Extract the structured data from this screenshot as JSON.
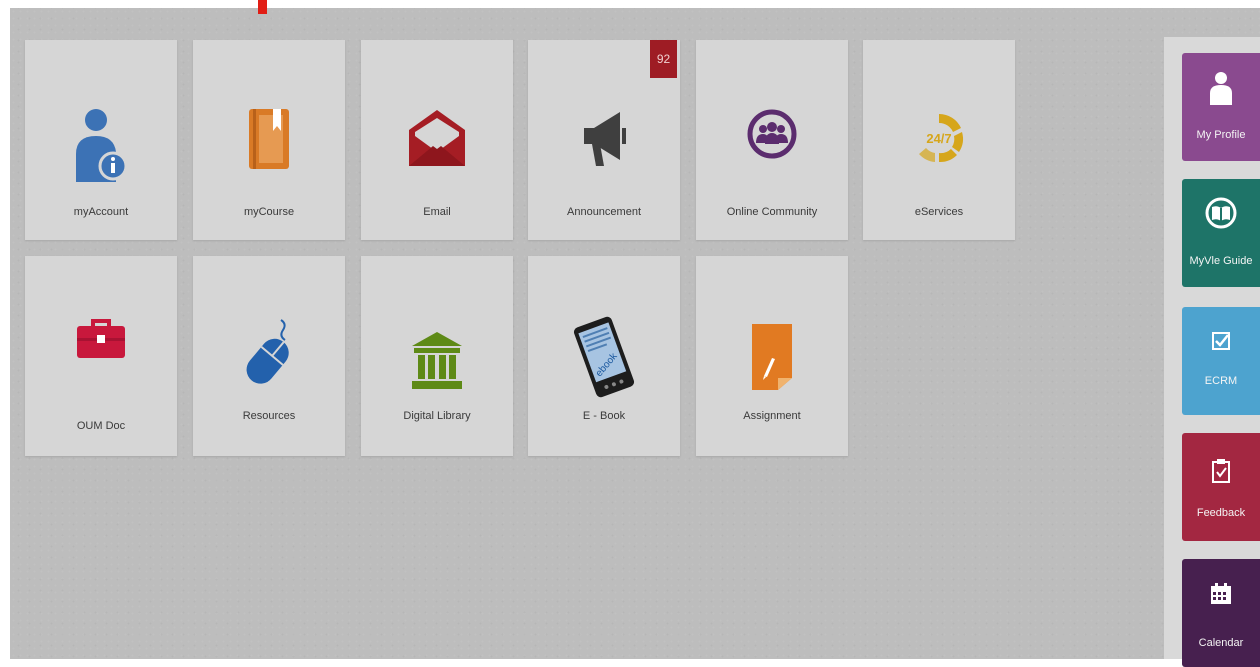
{
  "tiles": [
    {
      "label": "myAccount"
    },
    {
      "label": "myCourse"
    },
    {
      "label": "Email"
    },
    {
      "label": "Announcement",
      "badge": "92"
    },
    {
      "label": "Online Community"
    },
    {
      "label": "eServices",
      "icon_text": "24/7"
    },
    {
      "label": "OUM Doc"
    },
    {
      "label": "Resources"
    },
    {
      "label": "Digital Library"
    },
    {
      "label": "E - Book",
      "icon_text": "ebook"
    },
    {
      "label": "Assignment"
    }
  ],
  "sidebar": [
    {
      "label": "My Profile",
      "color": "#8a4a8f"
    },
    {
      "label": "MyVle Guide",
      "color": "#1e7468"
    },
    {
      "label": "ECRM",
      "color": "#4da3cf"
    },
    {
      "label": "Feedback",
      "color": "#a32741"
    },
    {
      "label": "Calendar",
      "color": "#47204f"
    }
  ],
  "colors": {
    "myaccount": "#3c72b5",
    "mycourse": "#d97a26",
    "email": "#a51d24",
    "announcement": "#3f3f3f",
    "community": "#5b2c6e",
    "eservices": "#d6a61b",
    "oumdoc": "#c8183c",
    "resources": "#2361ac",
    "library": "#5e8a16",
    "ebook": "#1d1d1d",
    "assignment": "#e17a22",
    "arrow": "#e11d14"
  }
}
